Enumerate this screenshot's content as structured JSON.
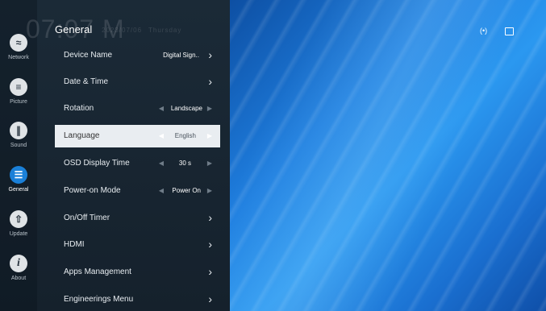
{
  "clock": {
    "time": "07:07 M",
    "date": "2023/07/06",
    "day": "Thursday"
  },
  "title": "General",
  "nav": [
    {
      "label": "Network",
      "icon": "wifi-icon",
      "glyph": "≈"
    },
    {
      "label": "Picture",
      "icon": "sliders-icon",
      "glyph": "≡"
    },
    {
      "label": "Sound",
      "icon": "sound-wave-icon",
      "glyph": "∥"
    },
    {
      "label": "General",
      "icon": "general-settings-icon",
      "glyph": "☰",
      "active": true
    },
    {
      "label": "Update",
      "icon": "update-arrow-icon",
      "glyph": "⇧"
    },
    {
      "label": "About",
      "icon": "info-icon",
      "glyph": "i"
    }
  ],
  "rows": [
    {
      "name": "Device Name",
      "value": "Digital Sign..",
      "type": "link"
    },
    {
      "name": "Date & Time",
      "value": "",
      "type": "link"
    },
    {
      "name": "Rotation",
      "value": "Landscape",
      "type": "option"
    },
    {
      "name": "Language",
      "value": "English",
      "type": "option",
      "selected": true
    },
    {
      "name": "OSD Display Time",
      "value": "30 s",
      "type": "option"
    },
    {
      "name": "Power-on Mode",
      "value": "Power On",
      "type": "option"
    },
    {
      "name": "On/Off Timer",
      "value": "",
      "type": "link"
    },
    {
      "name": "HDMI",
      "value": "",
      "type": "link"
    },
    {
      "name": "Apps Management",
      "value": "",
      "type": "link"
    },
    {
      "name": "Engineerings Menu",
      "value": "",
      "type": "link"
    }
  ],
  "status": {
    "cast_glyph": "(•)",
    "colors": {
      "accent": "#1a80d8",
      "selected_row": "#e9edf1"
    }
  }
}
